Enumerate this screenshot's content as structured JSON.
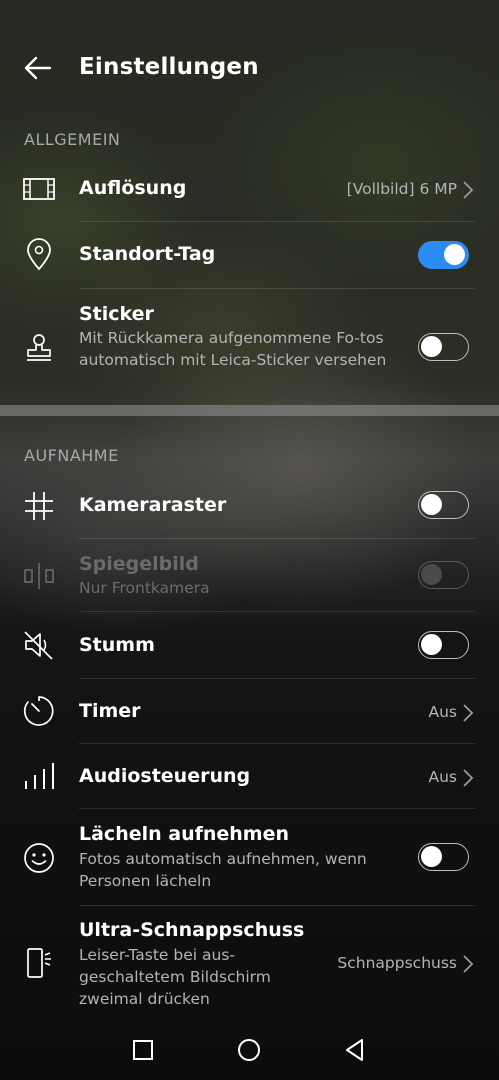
{
  "header": {
    "title": "Einstellungen",
    "back_icon": "arrow-left-icon"
  },
  "sections": {
    "general": "ALLGEMEIN",
    "capture": "AUFNAHME"
  },
  "rows": {
    "resolution": {
      "label": "Auflösung",
      "value": "[Vollbild] 6 MP",
      "icon": "film-frame-icon"
    },
    "location": {
      "label": "Standort-Tag",
      "toggle": "on",
      "icon": "location-pin-icon"
    },
    "sticker": {
      "label": "Sticker",
      "sub": "Mit Rückkamera aufgenommene Fo-tos automatisch mit Leica-Sticker versehen",
      "toggle": "off",
      "icon": "stamp-icon"
    },
    "grid": {
      "label": "Kameraraster",
      "toggle": "off",
      "icon": "grid-icon"
    },
    "mirror": {
      "label": "Spiegelbild",
      "sub": "Nur Frontkamera",
      "toggle": "disabled",
      "icon": "mirror-icon"
    },
    "mute": {
      "label": "Stumm",
      "toggle": "off",
      "icon": "speaker-muted-icon"
    },
    "timer": {
      "label": "Timer",
      "value": "Aus",
      "icon": "timer-icon"
    },
    "audio": {
      "label": "Audiosteuerung",
      "value": "Aus",
      "icon": "audio-bars-icon"
    },
    "smile": {
      "label": "Lächeln aufnehmen",
      "sub": "Fotos automatisch aufnehmen, wenn Personen lächeln",
      "toggle": "off",
      "icon": "smiley-icon"
    },
    "snapshot": {
      "label": "Ultra-Schnappschuss",
      "sub": "Leiser-Taste bei aus-geschaltetem Bildschirm zweimal drücken",
      "value": "Schnappschuss",
      "icon": "phone-side-button-icon"
    }
  },
  "colors": {
    "accent": "#2b8bf2",
    "text": "#ffffff",
    "secondary": "#b4b4b4"
  },
  "navbar": {
    "icons": [
      "square-recent-icon",
      "circle-home-icon",
      "triangle-back-icon"
    ]
  }
}
